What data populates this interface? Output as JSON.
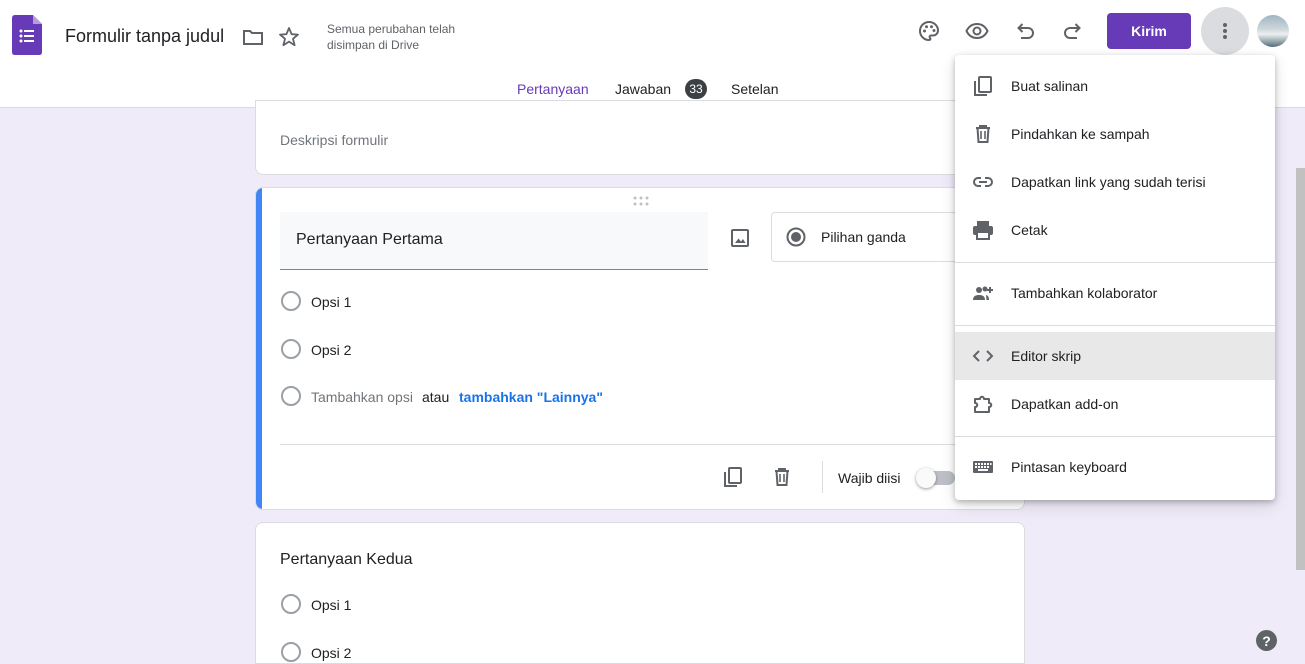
{
  "header": {
    "title": "Formulir tanpa judul",
    "save_status": "Semua perubahan telah disimpan di Drive",
    "send_label": "Kirim",
    "icons": [
      "forms-logo",
      "folder-icon",
      "star-icon",
      "palette-icon",
      "preview-eye-icon",
      "undo-icon",
      "redo-icon",
      "more-vert-icon"
    ]
  },
  "tabs": [
    {
      "label": "Pertanyaan",
      "active": true
    },
    {
      "label": "Jawaban",
      "badge": "33"
    },
    {
      "label": "Setelan"
    }
  ],
  "form": {
    "description_placeholder": "Deskripsi formulir",
    "question1": {
      "title": "Pertanyaan Pertama",
      "type_label": "Pilihan ganda",
      "options": [
        "Opsi 1",
        "Opsi 2"
      ],
      "add_option": "Tambahkan opsi",
      "or": "atau",
      "add_other": "tambahkan \"Lainnya\"",
      "required_label": "Wajib diisi"
    },
    "question2": {
      "title": "Pertanyaan Kedua",
      "options": [
        "Opsi 1",
        "Opsi 2"
      ]
    }
  },
  "menu": {
    "items": [
      {
        "label": "Buat salinan",
        "icon": "copy-icon"
      },
      {
        "label": "Pindahkan ke sampah",
        "icon": "trash-icon"
      },
      {
        "label": "Dapatkan link yang sudah terisi",
        "icon": "link-icon"
      },
      {
        "label": "Cetak",
        "icon": "print-icon"
      },
      {
        "label": "Tambahkan kolaborator",
        "icon": "add-people-icon"
      },
      {
        "label": "Editor skrip",
        "icon": "code-icon",
        "hovered": true
      },
      {
        "label": "Dapatkan add-on",
        "icon": "puzzle-icon"
      },
      {
        "label": "Pintasan keyboard",
        "icon": "keyboard-icon"
      }
    ]
  },
  "help_label": "?",
  "colors": {
    "brand": "#673ab7",
    "accent_blue": "#4285f4",
    "link_blue": "#1a73e8",
    "background": "#f0ebf8"
  }
}
